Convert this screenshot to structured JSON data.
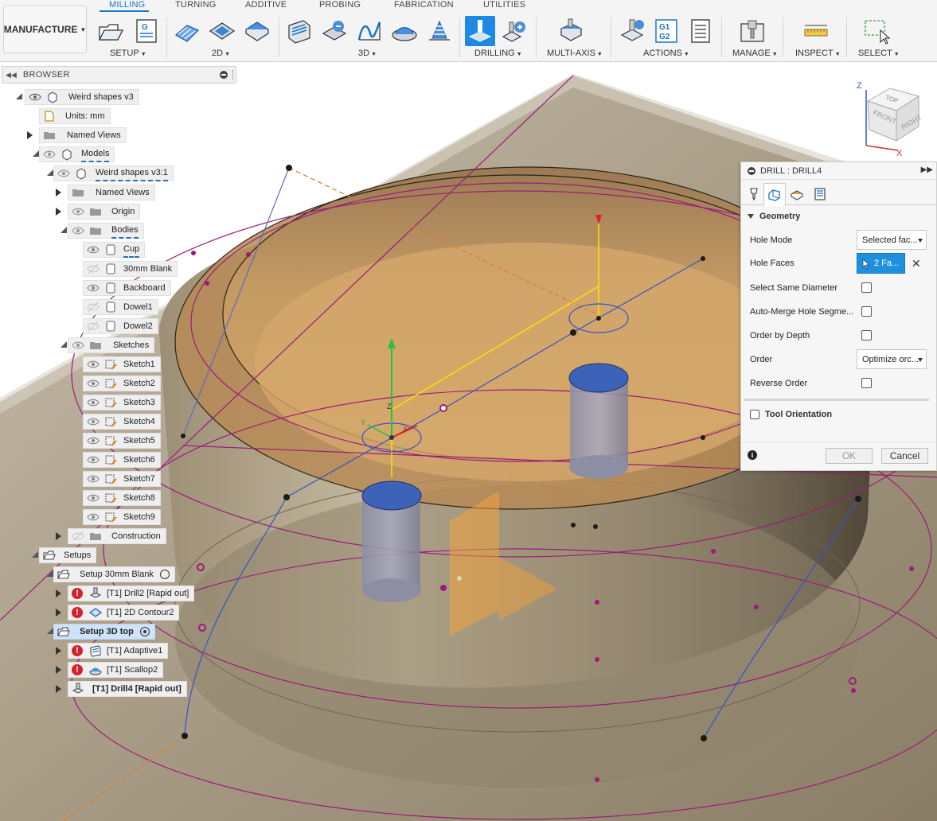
{
  "toolbar": {
    "workspace": "MANUFACTURE",
    "tabs": [
      "MILLING",
      "TURNING",
      "ADDITIVE",
      "PROBING",
      "FABRICATION",
      "UTILITIES"
    ],
    "groups": [
      "SETUP",
      "2D",
      "3D",
      "DRILLING",
      "MULTI-AXIS",
      "ACTIONS",
      "MANAGE",
      "INSPECT",
      "SELECT"
    ],
    "gcode_icon_text": "G1 G2",
    "accent_color": "#1a76c9"
  },
  "browser": {
    "title": "BROWSER",
    "items": [
      {
        "label": "Weird shapes v3"
      },
      {
        "label": "Units: mm"
      },
      {
        "label": "Named Views"
      },
      {
        "label": "Models"
      },
      {
        "label": "Weird shapes v3:1"
      },
      {
        "label": "Named Views"
      },
      {
        "label": "Origin"
      },
      {
        "label": "Bodies"
      },
      {
        "label": "Cup"
      },
      {
        "label": "30mm Blank"
      },
      {
        "label": "Backboard"
      },
      {
        "label": "Dowel1"
      },
      {
        "label": "Dowel2"
      },
      {
        "label": "Sketches"
      },
      {
        "label": "Sketch1"
      },
      {
        "label": "Sketch2"
      },
      {
        "label": "Sketch3"
      },
      {
        "label": "Sketch4"
      },
      {
        "label": "Sketch5"
      },
      {
        "label": "Sketch6"
      },
      {
        "label": "Sketch7"
      },
      {
        "label": "Sketch8"
      },
      {
        "label": "Sketch9"
      },
      {
        "label": "Construction"
      },
      {
        "label": "Setups"
      },
      {
        "label": "Setup 30mm Blank"
      },
      {
        "label": "[T1] Drill2 [Rapid out]"
      },
      {
        "label": "[T1] 2D Contour2"
      },
      {
        "label": "Setup 3D top"
      },
      {
        "label": "[T1] Adaptive1"
      },
      {
        "label": "[T1] Scallop2"
      },
      {
        "label": "[T1] Drill4 [Rapid out]"
      }
    ]
  },
  "viewcube": {
    "top": "TOP",
    "front": "FRONT",
    "right": "RIGHT",
    "axis_x": "X",
    "axis_z": "Z"
  },
  "triad": {
    "x": "X",
    "y": "Y",
    "z": "Z"
  },
  "drill_panel": {
    "title": "DRILL : DRILL4",
    "section": "Geometry",
    "rows": {
      "hole_mode": {
        "label": "Hole Mode",
        "value": "Selected fac..."
      },
      "hole_faces": {
        "label": "Hole Faces",
        "value": "2 Fa..."
      },
      "select_same_diameter": {
        "label": "Select Same Diameter",
        "checked": false
      },
      "auto_merge": {
        "label": "Auto-Merge Hole Segme...",
        "checked": false
      },
      "order_by_depth": {
        "label": "Order by Depth",
        "checked": false
      },
      "order": {
        "label": "Order",
        "value": "Optimize orc..."
      },
      "reverse_order": {
        "label": "Reverse Order",
        "checked": false
      }
    },
    "tool_orientation": "Tool Orientation",
    "ok": "OK",
    "cancel": "Cancel"
  }
}
